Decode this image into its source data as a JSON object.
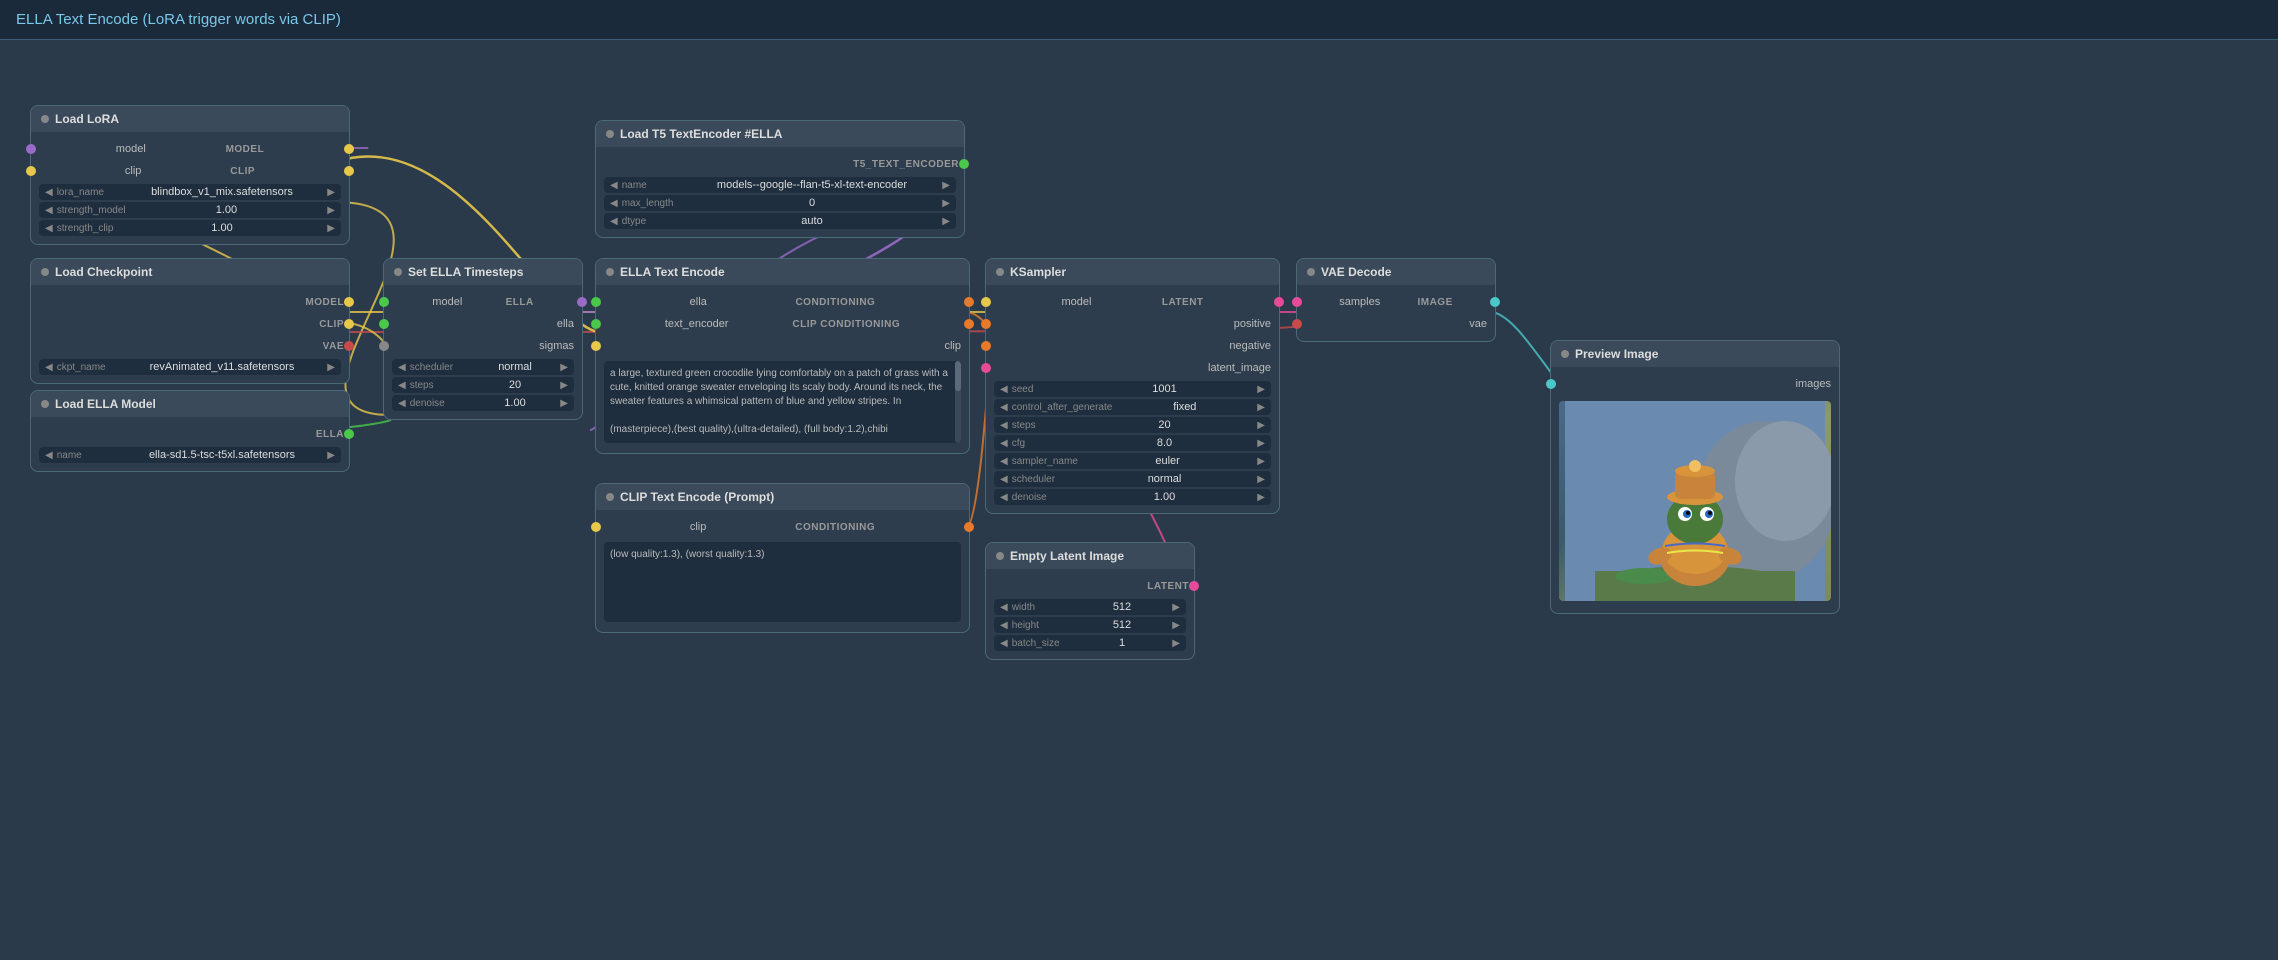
{
  "title": "ELLA Text Encode (LoRA trigger words via CLIP)",
  "nodes": {
    "load_lora": {
      "title": "Load LoRA",
      "ports_out": [
        "MODEL",
        "CLIP"
      ],
      "controls": [
        {
          "label": "lora_name",
          "value": "blindbox_v1_mix.safetensors"
        },
        {
          "label": "strength_model",
          "value": "1.00"
        },
        {
          "label": "strength_clip",
          "value": "1.00"
        }
      ]
    },
    "load_checkpoint": {
      "title": "Load Checkpoint",
      "ports_out": [
        "MODEL",
        "CLIP",
        "VAE"
      ],
      "controls": [
        {
          "label": "ckpt_name",
          "value": "revAnimated_v11.safetensors"
        }
      ]
    },
    "load_ella": {
      "title": "Load ELLA Model",
      "ports_out": [
        "ELLA"
      ],
      "controls": [
        {
          "label": "name",
          "value": "ella-sd1.5-tsc-t5xl.safetensors"
        }
      ]
    },
    "load_t5": {
      "title": "Load T5 TextEncoder #ELLA",
      "ports_out": [
        "T5_TEXT_ENCODER"
      ],
      "controls": [
        {
          "label": "name",
          "value": "models--google--flan-t5-xl-text-encoder"
        },
        {
          "label": "max_length",
          "value": "0"
        },
        {
          "label": "dtype",
          "value": "auto"
        }
      ]
    },
    "set_ella_timesteps": {
      "title": "Set ELLA Timesteps",
      "ports_in": [
        "model",
        "ella",
        "sigmas"
      ],
      "ports_out": [
        "ELLA"
      ],
      "controls": [
        {
          "label": "scheduler",
          "value": "normal"
        },
        {
          "label": "steps",
          "value": "20"
        },
        {
          "label": "denoise",
          "value": "1.00"
        }
      ]
    },
    "ella_text_encode": {
      "title": "ELLA Text Encode",
      "ports_in": [
        "ella",
        "text_encoder",
        "clip"
      ],
      "ports_out": [
        "CONDITIONING",
        "CLIP CONDITIONING"
      ],
      "text": "a large, textured green crocodile lying comfortably on a patch of grass with a cute, knitted orange sweater enveloping its scaly body. Around its neck, the sweater features a whimsical pattern of blue and yellow stripes. In\n\n(masterpiece),(best quality),(ultra-detailed), (full body:1.2),chibi"
    },
    "clip_text_encode": {
      "title": "CLIP Text Encode (Prompt)",
      "ports_in": [
        "clip"
      ],
      "ports_out": [
        "CONDITIONING"
      ],
      "text": "(low quality:1.3), (worst quality:1.3)"
    },
    "ksampler": {
      "title": "KSampler",
      "ports_in": [
        "model",
        "positive",
        "negative",
        "latent_image"
      ],
      "ports_out": [
        "LATENT"
      ],
      "controls": [
        {
          "label": "seed",
          "value": "1001"
        },
        {
          "label": "control_after_generate",
          "value": "fixed"
        },
        {
          "label": "steps",
          "value": "20"
        },
        {
          "label": "cfg",
          "value": "8.0"
        },
        {
          "label": "sampler_name",
          "value": "euler"
        },
        {
          "label": "scheduler",
          "value": "normal"
        },
        {
          "label": "denoise",
          "value": "1.00"
        }
      ]
    },
    "vae_decode": {
      "title": "VAE Decode",
      "ports_in": [
        "samples",
        "vae"
      ],
      "ports_out": [
        "IMAGE"
      ],
      "controls": []
    },
    "preview_image": {
      "title": "Preview Image",
      "ports_in": [
        "images"
      ],
      "controls": []
    },
    "empty_latent": {
      "title": "Empty Latent Image",
      "ports_out": [
        "LATENT"
      ],
      "controls": [
        {
          "label": "width",
          "value": "512"
        },
        {
          "label": "height",
          "value": "512"
        },
        {
          "label": "batch_size",
          "value": "1"
        }
      ]
    }
  },
  "wires": {
    "colors": {
      "model": "#e8c84a",
      "clip": "#e8c84a",
      "ella": "#9a6ac8",
      "conditioning": "#e87a2a",
      "latent": "#e84a9a",
      "image": "#4ac8c8",
      "t5": "#4ac84a"
    }
  }
}
